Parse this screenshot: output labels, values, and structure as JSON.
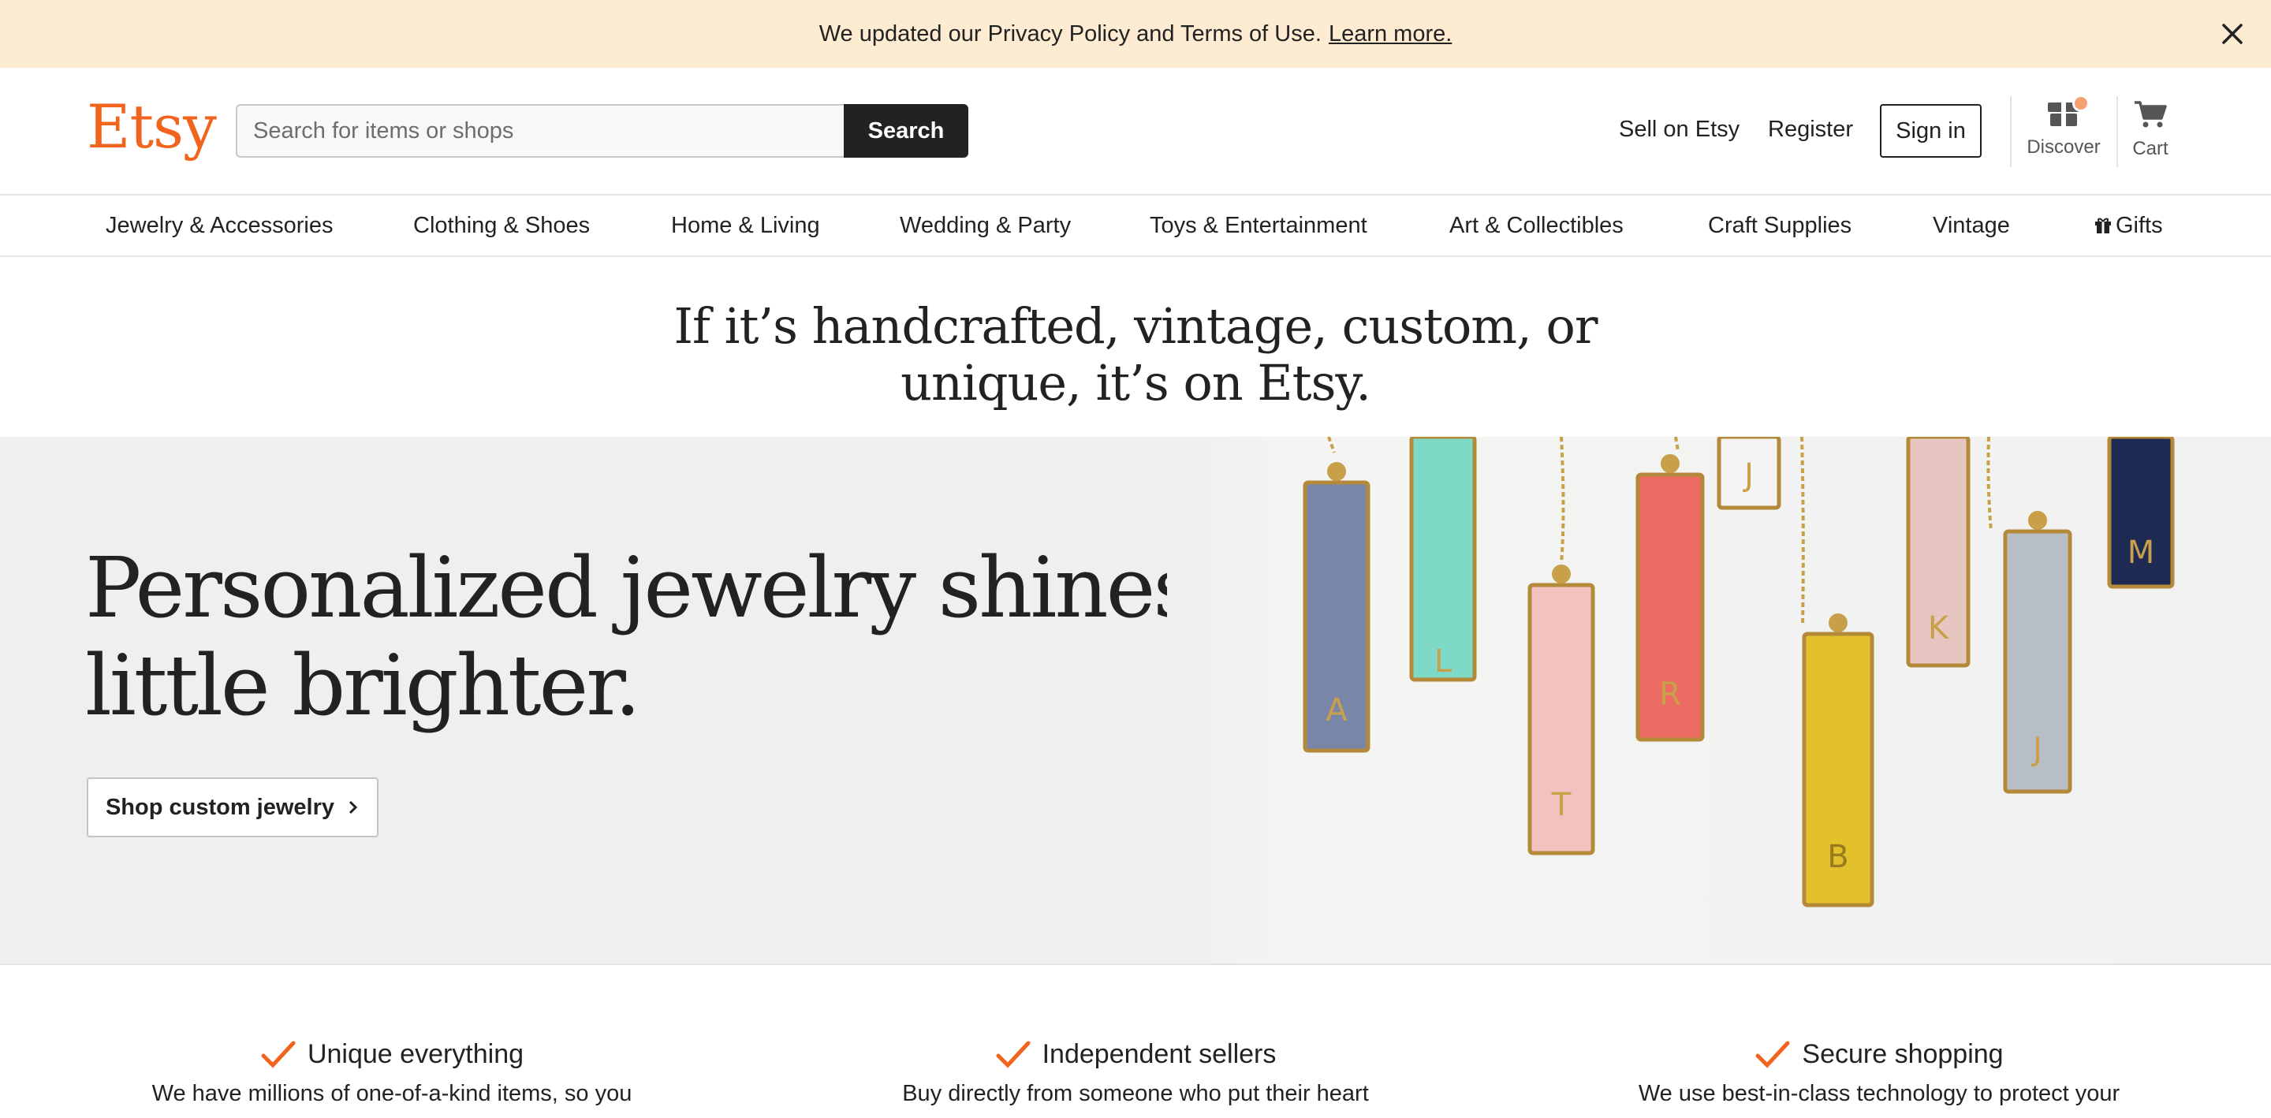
{
  "notice": {
    "text": "We updated our Privacy Policy and Terms of Use.",
    "link": "Learn more."
  },
  "header": {
    "logo": "Etsy",
    "search_placeholder": "Search for items or shops",
    "search_button": "Search",
    "sell": "Sell on Etsy",
    "register": "Register",
    "sign_in": "Sign in",
    "discover": "Discover",
    "cart": "Cart"
  },
  "categories": [
    "Jewelry & Accessories",
    "Clothing & Shoes",
    "Home & Living",
    "Wedding & Party",
    "Toys & Entertainment",
    "Art & Collectibles",
    "Craft Supplies",
    "Vintage",
    "Gifts"
  ],
  "tagline": {
    "line1": "If it’s handcrafted, vintage, custom, or",
    "line2": "unique, it’s on Etsy."
  },
  "hero": {
    "title_line1": "Personalized jewelry shines a",
    "title_line2": "little brighter.",
    "button": "Shop custom jewelry",
    "pendant_letters": [
      "A",
      "L",
      "T",
      "R",
      "J",
      "B",
      "K",
      "J",
      "M"
    ]
  },
  "features": [
    {
      "title": "Unique everything",
      "text": "We have millions of one-of-a-kind items, so you"
    },
    {
      "title": "Independent sellers",
      "text": "Buy directly from someone who put their heart"
    },
    {
      "title": "Secure shopping",
      "text": "We use best-in-class technology to protect your"
    }
  ],
  "colors": {
    "brand": "#f1641e",
    "notice_bg": "#fdebd2",
    "dark": "#222222",
    "check": "#f1641e"
  }
}
